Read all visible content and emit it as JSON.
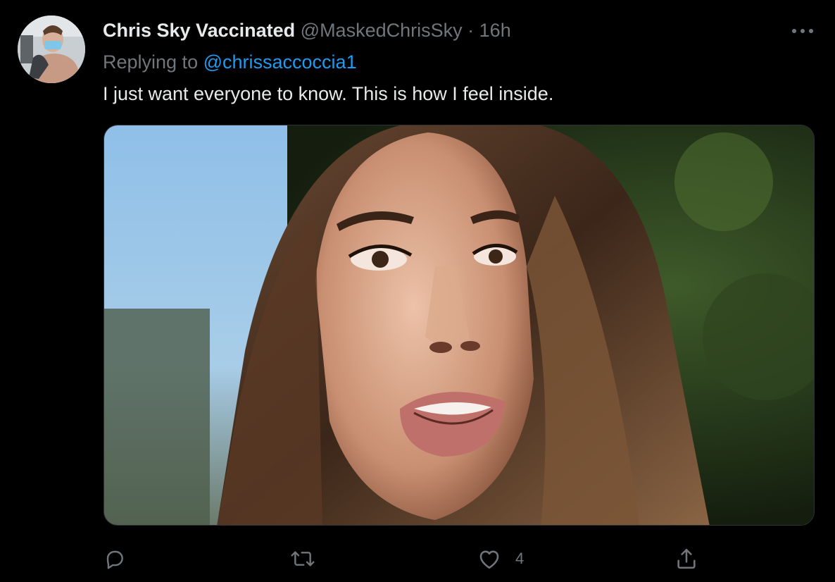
{
  "author": {
    "display_name": "Chris Sky Vaccinated",
    "handle": "@MaskedChrisSky",
    "separator": "·",
    "time": "16h"
  },
  "reply": {
    "prefix": "Replying to",
    "handle": "@chrissaccoccia1"
  },
  "tweet": {
    "text": "I just want everyone to know. This is how I feel inside."
  },
  "actions": {
    "reply_icon": "reply-icon",
    "retweet_icon": "retweet-icon",
    "like_icon": "heart-icon",
    "like_count": "4",
    "share_icon": "share-icon"
  },
  "colors": {
    "background": "#000000",
    "text": "#e7e9ea",
    "muted": "#71767b",
    "link": "#1d9bf0"
  }
}
